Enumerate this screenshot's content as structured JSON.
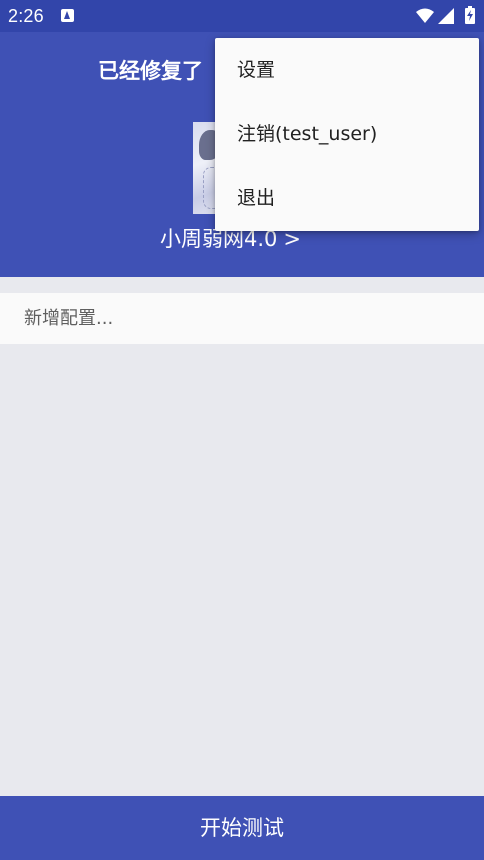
{
  "status_bar": {
    "time": "2:26",
    "icons": [
      "notification-a-icon",
      "wifi-icon",
      "signal-icon",
      "battery-charging-icon"
    ]
  },
  "header": {
    "title": "已经修复了",
    "account_name": "小周弱网4.0",
    "chevron": ">"
  },
  "main": {
    "add_config": "新增配置..."
  },
  "bottom_bar": {
    "start_test": "开始测试"
  },
  "menu": {
    "items": [
      {
        "label": "设置"
      },
      {
        "label": "注销(test_user)"
      },
      {
        "label": "退出"
      }
    ]
  },
  "colors": {
    "status_bar": "#3245aa",
    "primary": "#3f51b5",
    "background": "#e8e9ee",
    "menu_background": "#fafafa"
  }
}
